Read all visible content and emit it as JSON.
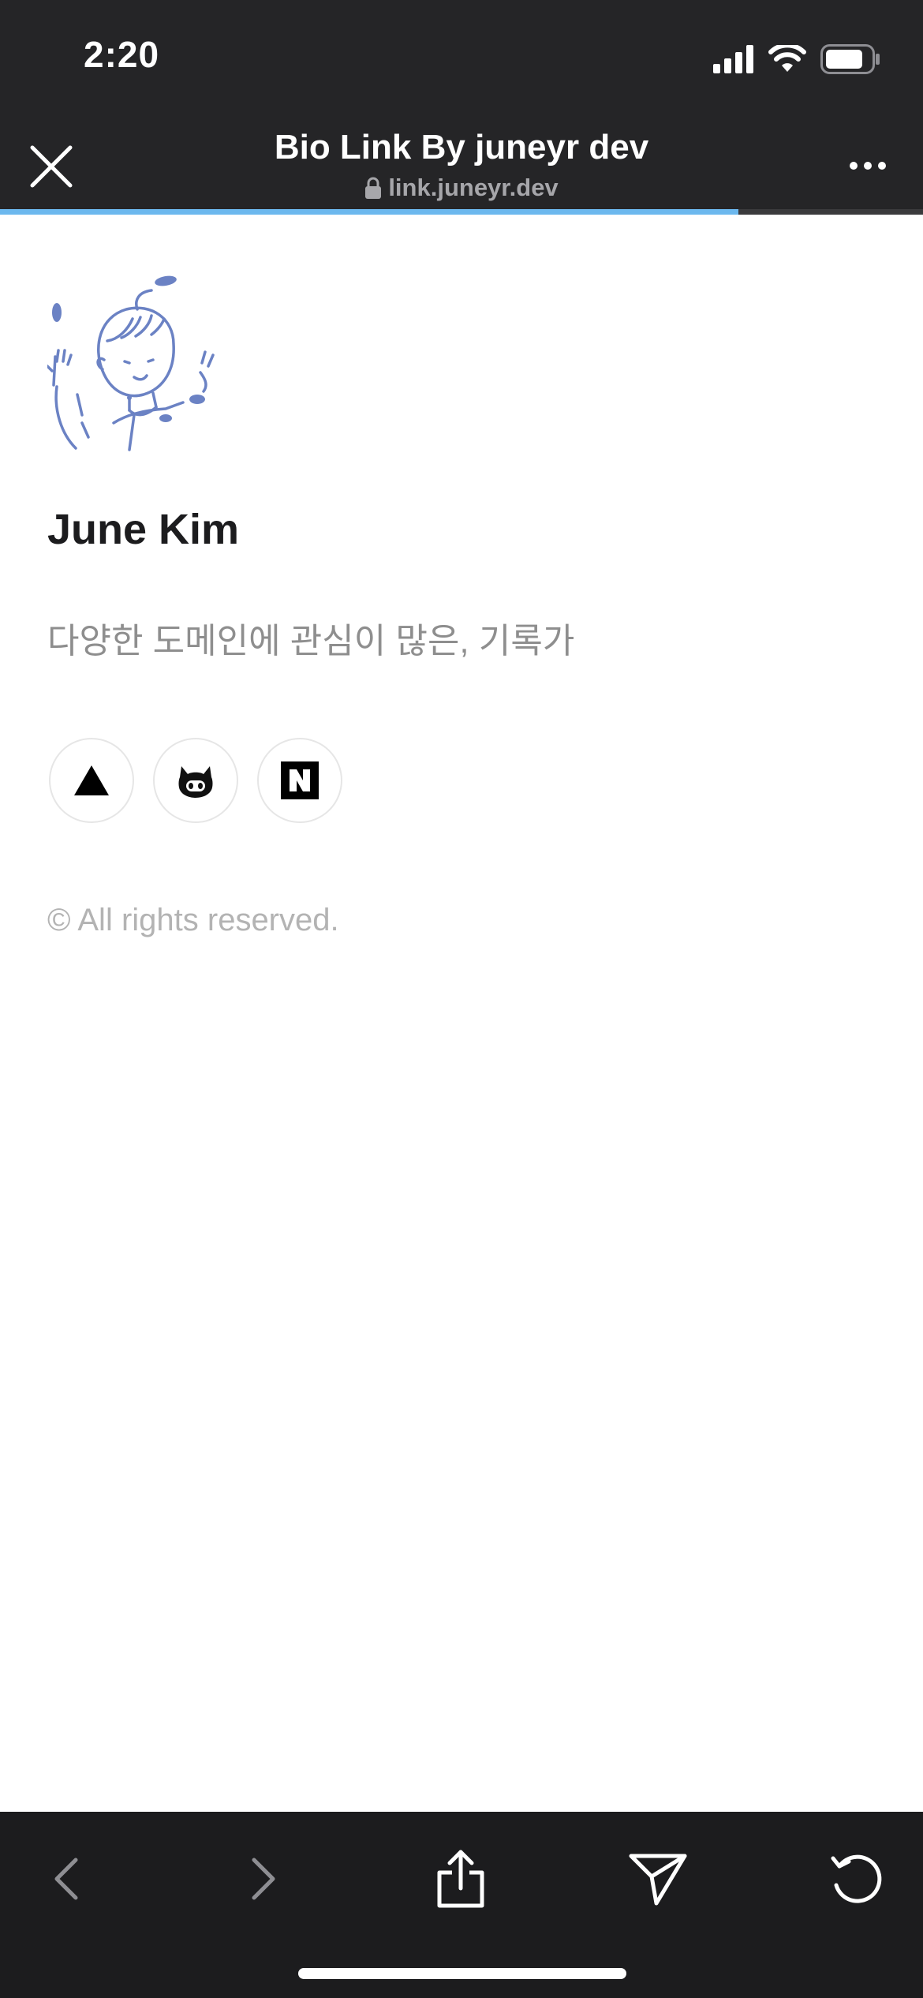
{
  "status_bar": {
    "time": "2:20"
  },
  "browser": {
    "title": "Bio Link By juneyr dev",
    "url": "link.juneyr.dev",
    "progress_fraction": 0.8,
    "progress_color": "#6cb8ee",
    "close_icon": "close-icon",
    "more_icon": "more-horizontal-icon"
  },
  "profile": {
    "name": "June Kim",
    "bio": "다양한 도메인에 관심이 많은, 기록가",
    "avatar_color": "#6b82c4"
  },
  "social_links": [
    {
      "icon": "triangle-icon"
    },
    {
      "icon": "github-icon"
    },
    {
      "icon": "naver-icon"
    }
  ],
  "footer": {
    "copyright": "© All rights reserved."
  },
  "toolbar": {
    "items": [
      "back-icon",
      "forward-icon",
      "share-icon",
      "send-icon",
      "reload-icon"
    ]
  }
}
